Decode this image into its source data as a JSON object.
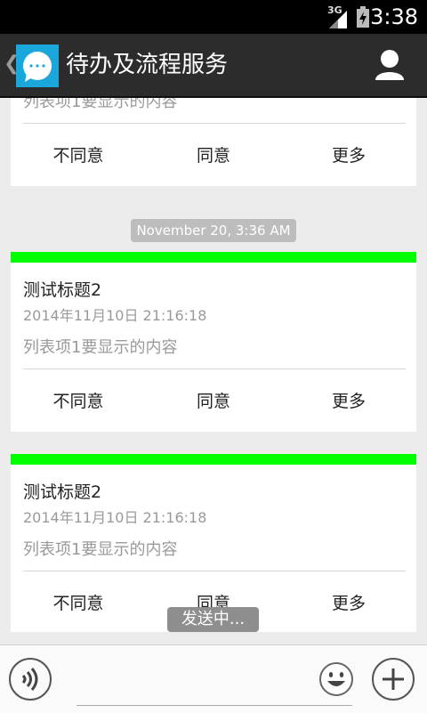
{
  "status_bar": {
    "network": "3G",
    "time": "3:38"
  },
  "action_bar": {
    "title": "待办及流程服务",
    "back_glyph": "❮",
    "icons": [
      "app-chat-icon",
      "user-icon"
    ]
  },
  "cards": [
    {
      "title": "",
      "date": "",
      "body": "列表项1要显示的内容",
      "actions": [
        "不同意",
        "同意",
        "更多"
      ]
    },
    {
      "title": "测试标题2",
      "date": "2014年11月10日 21:16:18",
      "body": "列表项1要显示的内容",
      "actions": [
        "不同意",
        "同意",
        "更多"
      ]
    },
    {
      "title": "测试标题2",
      "date": "2014年11月10日 21:16:18",
      "body": "列表项1要显示的内容",
      "actions": [
        "不同意",
        "同意",
        "更多"
      ]
    }
  ],
  "timestamp": "November 20, 3:36 AM",
  "toast": "发送中...",
  "input_bar": {
    "icons": [
      "voice-icon",
      "emoji-icon",
      "plus-icon"
    ]
  },
  "colors": {
    "accent_green": "#00ff00",
    "action_bar_bg": "#2c2c2c",
    "app_icon_blue": "#1aa8dc",
    "content_bg": "#ececec"
  }
}
